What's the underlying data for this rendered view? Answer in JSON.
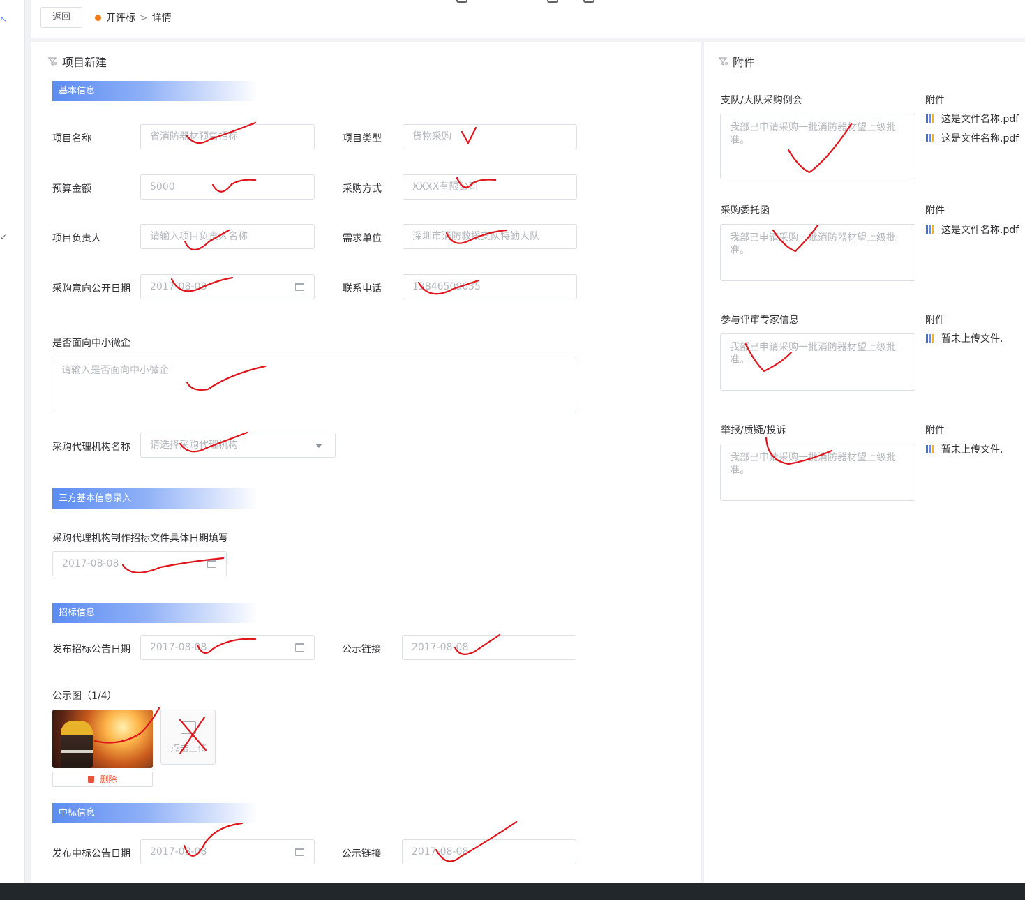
{
  "header": {
    "back_label": "返回",
    "crumb_parent": "开评标",
    "crumb_sep": ">",
    "crumb_current": "详情"
  },
  "main": {
    "title": "项目新建",
    "sections": {
      "basic": "基本信息",
      "third_party": "三方基本信息录入",
      "bidding": "招标信息",
      "award": "中标信息"
    },
    "fields": {
      "project_name": {
        "label": "项目名称",
        "placeholder": "省消防器材预售招标"
      },
      "project_type": {
        "label": "项目类型",
        "placeholder": "货物采购"
      },
      "budget": {
        "label": "预算金额",
        "placeholder": "5000"
      },
      "purchase_method": {
        "label": "采购方式",
        "placeholder": "XXXX有限公司"
      },
      "project_owner": {
        "label": "项目负责人",
        "placeholder": "请输入项目负责人名称"
      },
      "demand_unit": {
        "label": "需求单位",
        "placeholder": "深圳市消防救援支队特勤大队"
      },
      "disclosure_date": {
        "label": "采购意向公开日期",
        "placeholder": "2017-08-08"
      },
      "phone": {
        "label": "联系电话",
        "placeholder": "13846509635"
      },
      "sme": {
        "label": "是否面向中小微企",
        "placeholder": "请输入是否面向中小微企"
      },
      "agency": {
        "label": "采购代理机构名称",
        "placeholder": "请选择采购代理机构"
      },
      "doc_date": {
        "label": "采购代理机构制作招标文件具体日期填写",
        "placeholder": "2017-08-08"
      },
      "bid_notice_date": {
        "label": "发布招标公告日期",
        "placeholder": "2017-08-08"
      },
      "bid_notice_link": {
        "label": "公示链接",
        "placeholder": "2017-08-08"
      },
      "notice_images": {
        "label": "公示图（1/4）",
        "upload_label": "点击上传",
        "delete_label": "删除"
      },
      "award_notice_date": {
        "label": "发布中标公告日期",
        "placeholder": "2017-08-08"
      },
      "award_notice_link": {
        "label": "公示链接",
        "placeholder": "2017-08-08"
      }
    }
  },
  "side": {
    "title": "附件",
    "attach_label": "附件",
    "groups": [
      {
        "label": "支队/大队采购例会",
        "text": "我部已申请采购一批消防器材望上级批准。",
        "files": [
          "这是文件名称.pdf",
          "这是文件名称.pdf"
        ]
      },
      {
        "label": "采购委托函",
        "text": "我部已申请采购一批消防器材望上级批准。",
        "files": [
          "这是文件名称.pdf"
        ]
      },
      {
        "label": "参与评审专家信息",
        "text": "我部已申请采购一批消防器材望上级批准。",
        "files": [
          "暂未上传文件."
        ]
      },
      {
        "label": "举报/质疑/投诉",
        "text": "我部已申请采购一批消防器材望上级批准。",
        "files": [
          "暂未上传文件."
        ]
      }
    ]
  },
  "colors": {
    "accent": "#5c8cf2",
    "status_dot": "#f07b1b",
    "delete": "#e6553a",
    "annotation_ink": "#e0141b"
  }
}
